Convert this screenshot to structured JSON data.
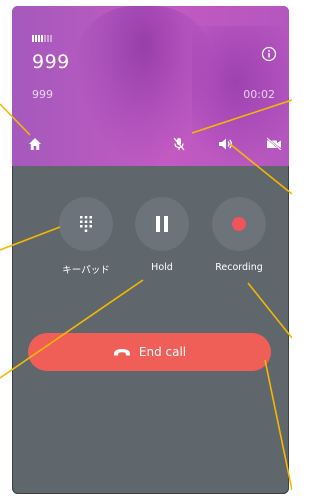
{
  "call": {
    "number": "999",
    "sub_number": "999",
    "duration": "00:02",
    "signal_bars_on": 4,
    "signal_bars_total": 7
  },
  "actions": [
    {
      "label": "キーパッド",
      "icon": "keypad-icon"
    },
    {
      "label": "Hold",
      "icon": "pause-icon"
    },
    {
      "label": "Recording",
      "icon": "record-icon"
    }
  ],
  "end_call": {
    "label": "End call",
    "icon": "hang-up-icon"
  },
  "header_icons": [
    "info-icon",
    "home-icon",
    "mic-off-icon",
    "speaker-icon",
    "video-off-icon"
  ],
  "colors": {
    "header": "#b35ac0",
    "background": "#5f666c",
    "button_circle": "#6c737a",
    "end_call": "#ef5f57",
    "record_dot": "#f2525a",
    "callout_line": "#f5b800"
  }
}
